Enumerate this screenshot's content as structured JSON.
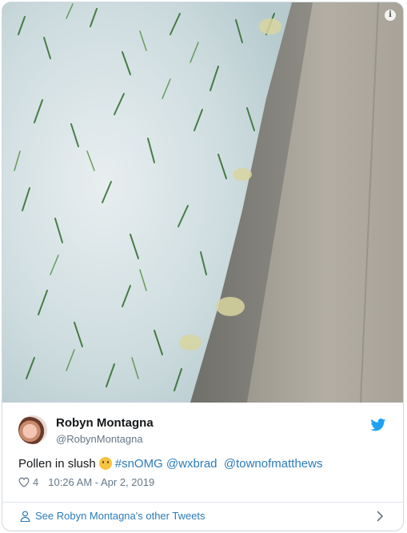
{
  "tweet": {
    "author_name": "Robyn Montagna",
    "author_handle": "@RobynMontagna",
    "text_plain": "Pollen in slush",
    "hashtag": "#snOMG",
    "mention1": "@wxbrad",
    "mention2": "@townofmatthews",
    "like_count": "4",
    "timestamp": "10:26 AM - Apr 2, 2019"
  },
  "footer": {
    "other_tweets_label": "See Robyn Montagna's other Tweets"
  },
  "icons": {
    "info": "info-icon",
    "twitter": "twitter-bird-icon",
    "heart": "heart-icon",
    "person": "person-icon",
    "chevron": "chevron-right-icon",
    "emoji": "upside-down-face-emoji"
  },
  "colors": {
    "link": "#2b7bb9",
    "twitter_blue": "#1da1f2",
    "muted": "#657786",
    "text": "#14171a",
    "border": "#cfd9de"
  }
}
